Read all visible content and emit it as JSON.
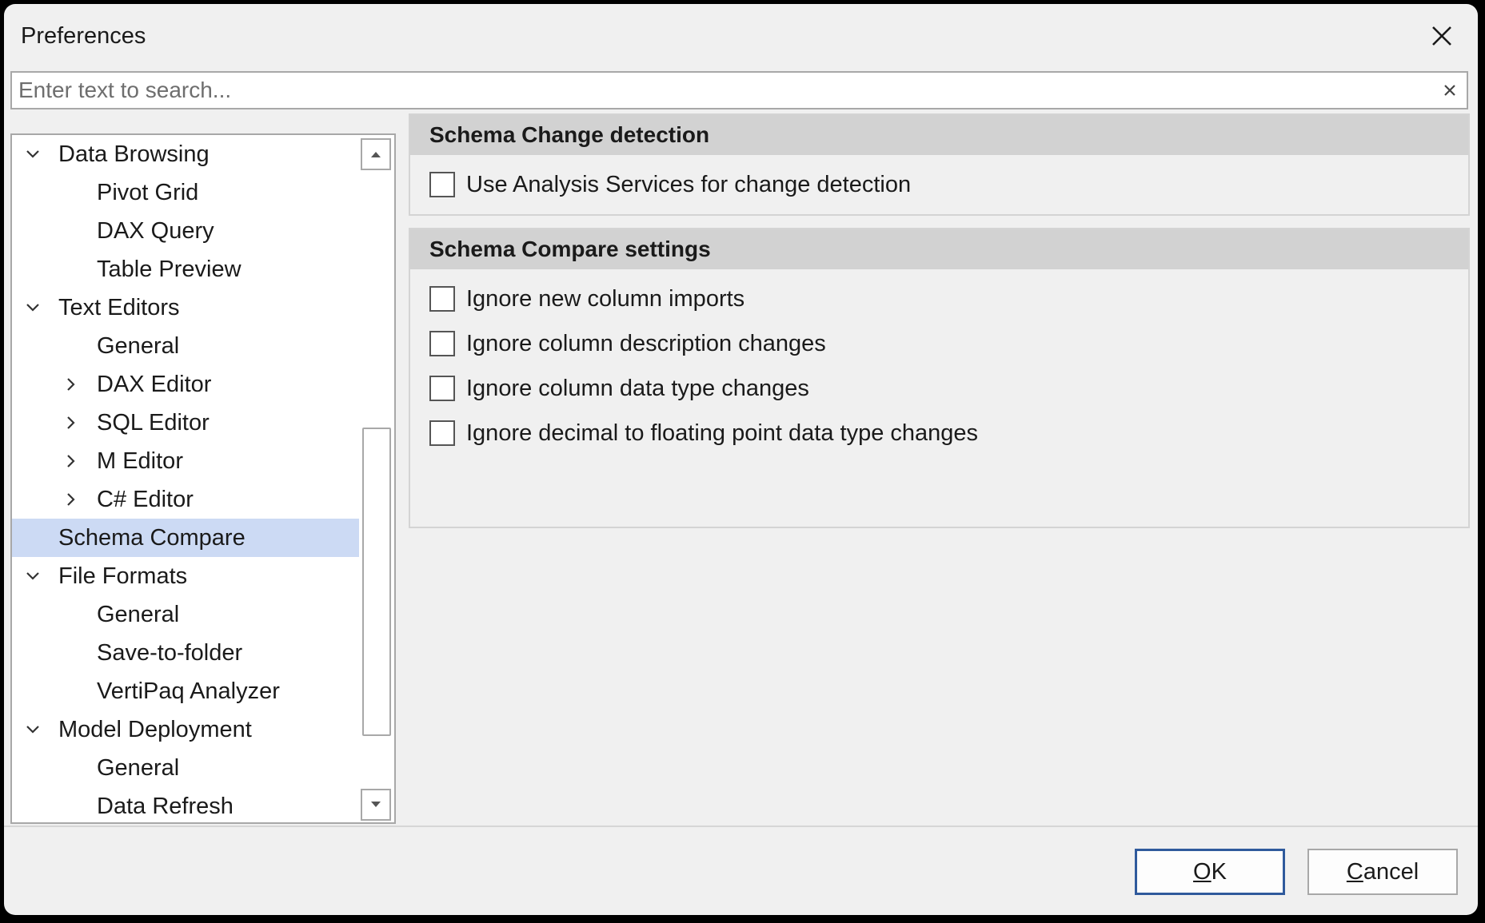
{
  "window": {
    "title": "Preferences"
  },
  "search": {
    "placeholder": "Enter text to search..."
  },
  "tree": {
    "items": [
      {
        "label": "Data Browsing",
        "level": 0,
        "expander": "expanded"
      },
      {
        "label": "Pivot Grid",
        "level": 1,
        "expander": "none"
      },
      {
        "label": "DAX Query",
        "level": 1,
        "expander": "none"
      },
      {
        "label": "Table Preview",
        "level": 1,
        "expander": "none"
      },
      {
        "label": "Text Editors",
        "level": 0,
        "expander": "expanded"
      },
      {
        "label": "General",
        "level": 1,
        "expander": "none"
      },
      {
        "label": "DAX Editor",
        "level": 1,
        "expander": "collapsed"
      },
      {
        "label": "SQL Editor",
        "level": 1,
        "expander": "collapsed"
      },
      {
        "label": "M Editor",
        "level": 1,
        "expander": "collapsed"
      },
      {
        "label": "C# Editor",
        "level": 1,
        "expander": "collapsed"
      },
      {
        "label": "Schema Compare",
        "level": 0,
        "expander": "none",
        "selected": true
      },
      {
        "label": "File Formats",
        "level": 0,
        "expander": "expanded"
      },
      {
        "label": "General",
        "level": 1,
        "expander": "none"
      },
      {
        "label": "Save-to-folder",
        "level": 1,
        "expander": "none"
      },
      {
        "label": "VertiPaq Analyzer",
        "level": 1,
        "expander": "none"
      },
      {
        "label": "Model Deployment",
        "level": 0,
        "expander": "expanded"
      },
      {
        "label": "General",
        "level": 1,
        "expander": "none"
      },
      {
        "label": "Data Refresh",
        "level": 1,
        "expander": "none"
      }
    ]
  },
  "change_detection": {
    "header": "Schema Change detection",
    "options": [
      {
        "label": "Use Analysis Services for change detection",
        "checked": false
      }
    ]
  },
  "compare_settings": {
    "header": "Schema Compare settings",
    "options": [
      {
        "label": "Ignore new column imports",
        "checked": false
      },
      {
        "label": "Ignore column description changes",
        "checked": false
      },
      {
        "label": "Ignore column data type changes",
        "checked": false
      },
      {
        "label": "Ignore decimal to floating point data type changes",
        "checked": false
      }
    ]
  },
  "buttons": {
    "ok": {
      "mnemonic": "O",
      "rest": "K"
    },
    "cancel": {
      "mnemonic": "C",
      "rest": "ancel"
    }
  },
  "colors": {
    "selection": "#ccdaf4",
    "default_button_border": "#2f5a9c",
    "group_header": "#d2d2d2"
  }
}
